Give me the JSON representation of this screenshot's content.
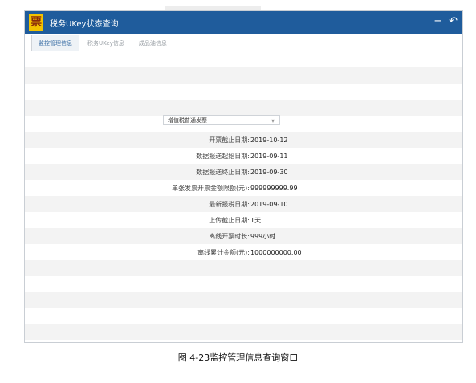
{
  "window": {
    "title": "税务UKey状态查询",
    "logo_text": "票",
    "controls": {
      "minimize": "−",
      "back": "↶"
    }
  },
  "tabs": [
    {
      "label": "监控管理信息",
      "active": true
    },
    {
      "label": "税务UKey信息",
      "active": false
    },
    {
      "label": "成品油信息",
      "active": false
    }
  ],
  "invoice_type_select": {
    "value": "增值税普通发票"
  },
  "fields": [
    {
      "label": "开票截止日期:",
      "value": "2019-10-12"
    },
    {
      "label": "数据报送起始日期:",
      "value": "2019-09-11"
    },
    {
      "label": "数据报送终止日期:",
      "value": "2019-09-30"
    },
    {
      "label": "单张发票开票金额限额(元):",
      "value": "999999999.99"
    },
    {
      "label": "最新报税日期:",
      "value": "2019-09-10"
    },
    {
      "label": "上传截止日期:",
      "value": "1天"
    },
    {
      "label": "离线开票时长:",
      "value": "999小时"
    },
    {
      "label": "离线累计金额(元):",
      "value": "1000000000.00"
    }
  ],
  "caption": "图 4-23监控管理信息查询窗口",
  "colors": {
    "titlebar": "#1f5c9c",
    "logo_bg": "#f2c200",
    "active_tab": "#3a6ea5"
  }
}
